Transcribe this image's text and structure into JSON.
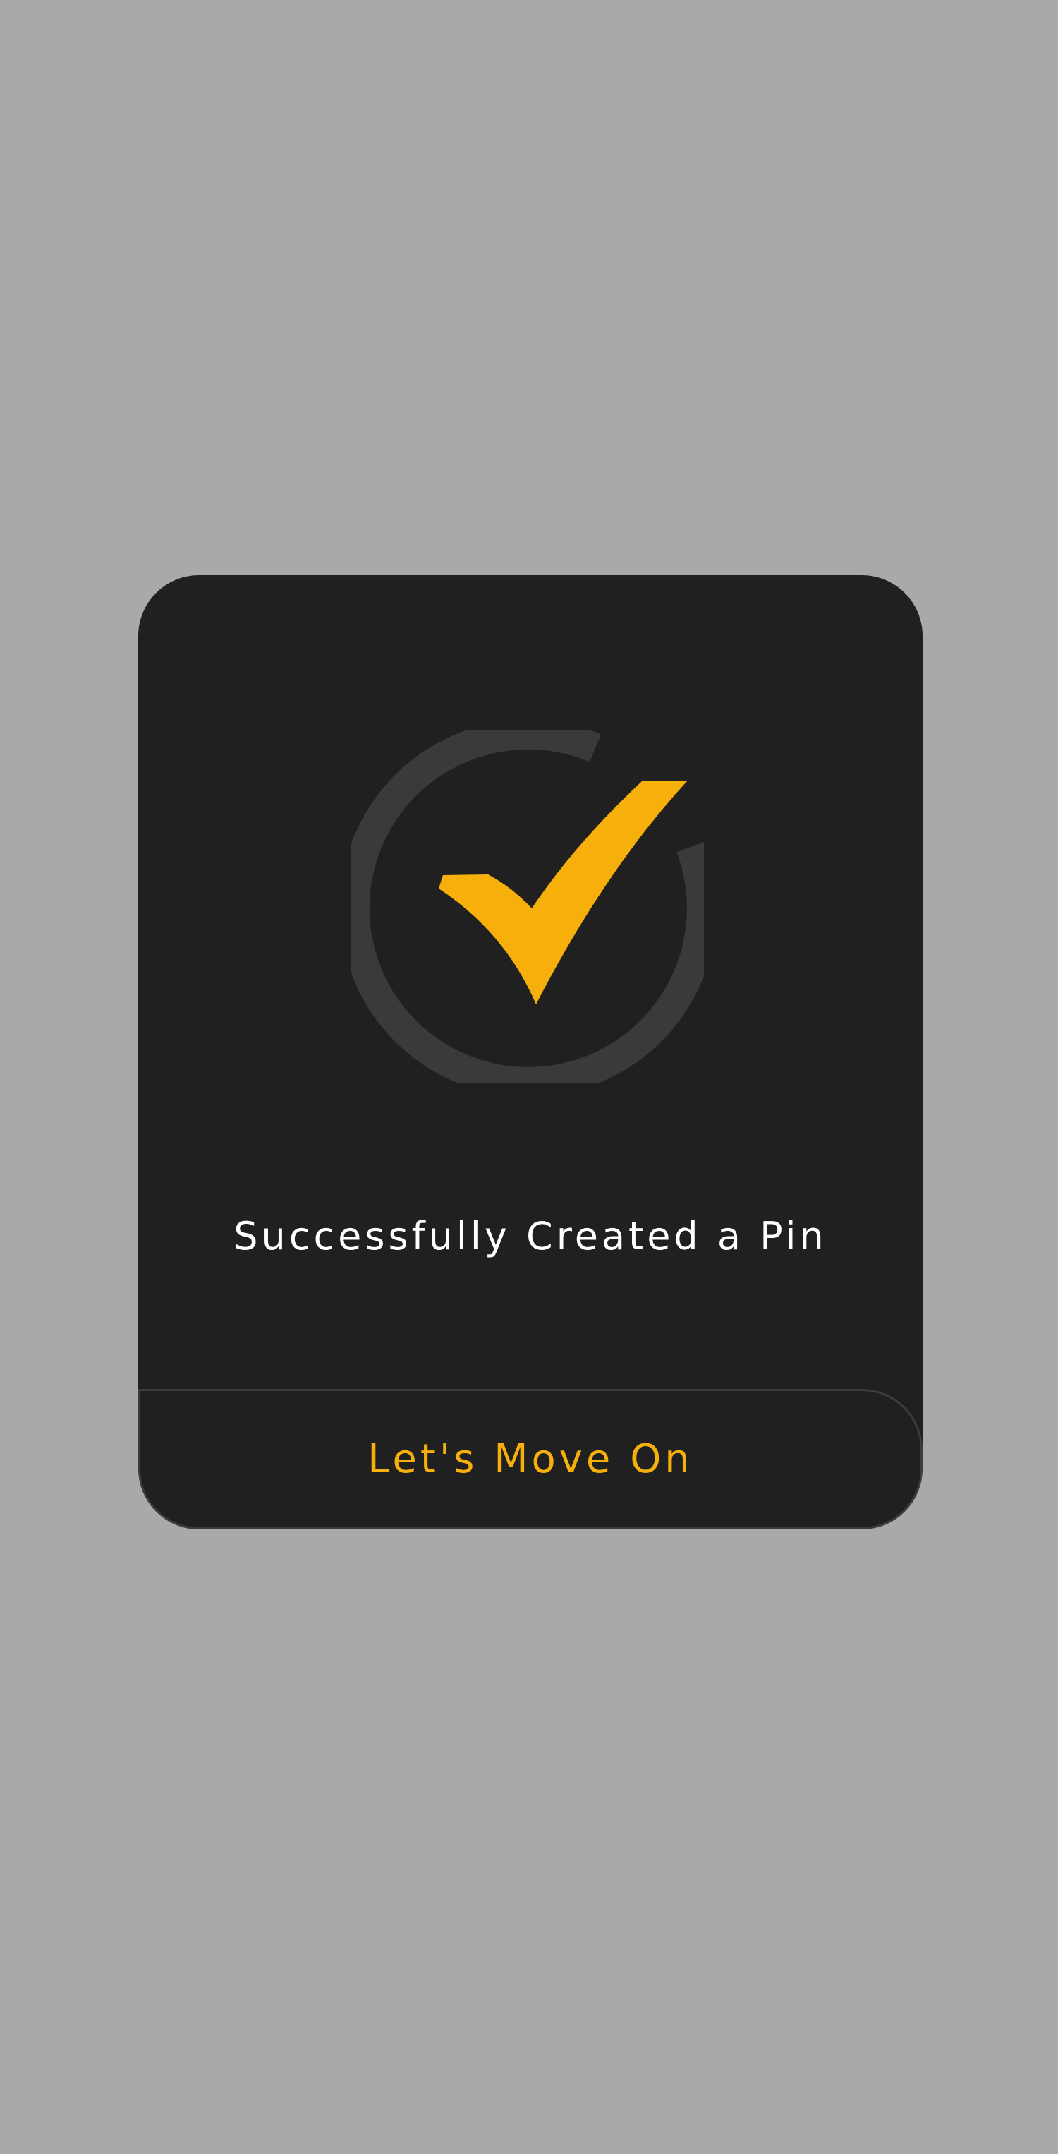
{
  "colors": {
    "backdrop": "#a9a9a9",
    "dialog_background": "#202020",
    "icon_ring": "#3a3a3a",
    "accent": "#f7b00b",
    "message_text": "#ffffff",
    "button_border": "#3c3c3c"
  },
  "dialog": {
    "icon": "check-circle-icon",
    "message": "Successfully Created a Pin",
    "button_label": "Let's Move On"
  }
}
